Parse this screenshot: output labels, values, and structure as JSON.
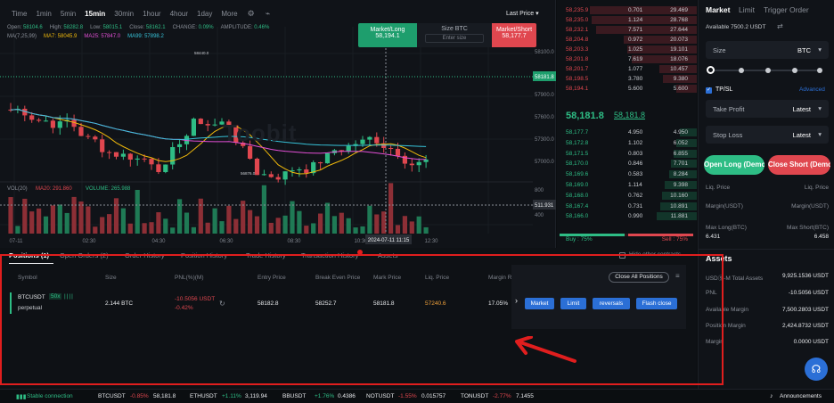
{
  "timeframes": [
    "Time",
    "1min",
    "5min",
    "15min",
    "30min",
    "1hour",
    "4hour",
    "1day",
    "More"
  ],
  "active_timeframe": "15min",
  "last_price_selector": "Last Price",
  "ohlc": {
    "open_label": "Open:",
    "open": "58104.6",
    "high_label": "High:",
    "high": "58282.8",
    "low_label": "Low:",
    "low": "58015.1",
    "close_label": "Close:",
    "close": "58162.1",
    "change_label": "CHANGE:",
    "change": "0.09%",
    "amplitude_label": "AMPLITUDE:",
    "amplitude": "0.46%"
  },
  "ma": {
    "setting": "MA(7,25,99)",
    "ma7": "MA7: 58045.9",
    "ma25": "MA25: 57847.0",
    "ma99": "MA99: 57898.2"
  },
  "watermark": "Toobit",
  "price_axis": [
    "58100.0",
    "57900.0",
    "57600.0",
    "57300.0",
    "57000.0"
  ],
  "current_price_tag": "58181.8",
  "price_annotations": {
    "high": "58440.0",
    "low": "56876.0"
  },
  "volume_axis": [
    "800",
    "400"
  ],
  "volume_tag": "511.931",
  "volume_legend": {
    "label": "VOL(20)",
    "ma20": "MA20: 291.860",
    "volume": "VOLUME: 265.988"
  },
  "time_axis": [
    "07-11",
    "02:30",
    "04:30",
    "06:30",
    "08:30",
    "10:30",
    "12:30"
  ],
  "crosshair_time": "2024-07-11 11:15",
  "quick_trade": {
    "long_label": "Market/Long",
    "long_price": "58,194.1",
    "size_label": "Size BTC",
    "size_placeholder": "Enter size",
    "short_label": "Market/Short",
    "short_price": "58,177.7"
  },
  "orderbook": {
    "asks": [
      [
        "58,235.9",
        "0.701",
        "29.469"
      ],
      [
        "58,235.0",
        "1.124",
        "28.768"
      ],
      [
        "58,232.1",
        "7.571",
        "27.644"
      ],
      [
        "58,204.8",
        "0.972",
        "20.073"
      ],
      [
        "58,203.3",
        "1.025",
        "19.101"
      ],
      [
        "58,201.8",
        "7.619",
        "18.076"
      ],
      [
        "58,201.7",
        "1.077",
        "10.457"
      ],
      [
        "58,198.5",
        "3.780",
        "9.380"
      ],
      [
        "58,194.1",
        "5.600",
        "5.600"
      ]
    ],
    "ask_depth": [
      1.0,
      0.98,
      0.94,
      0.68,
      0.65,
      0.61,
      0.35,
      0.32,
      0.19
    ],
    "mid_price": "58,181.8",
    "mark_price": "58,181.8",
    "bids": [
      [
        "58,177.7",
        "4.950",
        "4.950"
      ],
      [
        "58,172.8",
        "1.102",
        "6.052"
      ],
      [
        "58,171.5",
        "0.803",
        "6.855"
      ],
      [
        "58,170.0",
        "0.846",
        "7.701"
      ],
      [
        "58,169.6",
        "0.583",
        "8.284"
      ],
      [
        "58,169.0",
        "1.114",
        "9.398"
      ],
      [
        "58,168.0",
        "0.762",
        "10.160"
      ],
      [
        "58,167.4",
        "0.731",
        "10.891"
      ],
      [
        "58,166.0",
        "0.990",
        "11.881"
      ]
    ],
    "bid_depth": [
      0.42,
      0.51,
      0.58,
      0.65,
      0.7,
      0.79,
      0.86,
      0.92,
      1.0
    ],
    "buy_ratio": "Buy : 75%",
    "sell_ratio": "Sell : 75%",
    "buy_fraction": 0.5
  },
  "right_panel": {
    "tabs": [
      "Market",
      "Limit",
      "Trigger Order"
    ],
    "available": "Available 7500.2 USDT",
    "size_label": "Size",
    "size_unit": "BTC",
    "tpsl_label": "TP/SL",
    "advanced_label": "Advanced",
    "take_profit_label": "Take Profit",
    "take_profit_value": "Latest",
    "stop_loss_label": "Stop Loss",
    "stop_loss_value": "Latest",
    "open_long": "Open Long (Demo)",
    "open_short": "Close Short (Demo)",
    "liq_left": "Liq. Price",
    "liq_right": "Liq. Price",
    "margin_left": "Margin(USDT)",
    "margin_right": "Margin(USDT)",
    "maxlong_label": "Max Long(BTC)",
    "maxlong_value": "6.431",
    "maxshort_label": "Max Short(BTC)",
    "maxshort_value": "6.458",
    "assets_title": "Assets",
    "assets_rows": [
      [
        "USDⓈ-M Total Assets",
        "9,925.1536 USDT"
      ],
      [
        "PNL",
        "-10.5056 USDT"
      ],
      [
        "Available Margin",
        "7,500.2803 USDT"
      ],
      [
        "Position Margin",
        "2,424.8732 USDT"
      ],
      [
        "Margin",
        "0.0000 USDT"
      ]
    ]
  },
  "positions": {
    "tabs": [
      "Positions (1)",
      "Open Orders (2)",
      "Order History",
      "Position History",
      "Trade History",
      "Transaction History",
      "Assets"
    ],
    "hide_other": "Hide other contracts",
    "headers": [
      "Symbol",
      "Size",
      "PNL(%)(M)",
      "Entry Price",
      "Break Even Price",
      "Mark Price",
      "Liq. Price",
      "Margin R"
    ],
    "close_all": "Close All Positions",
    "row": {
      "symbol": "BTCUSDT",
      "leverage": "50x",
      "type": "perpetual",
      "size": "2.144 BTC",
      "pnl": "-10.5056 USDT",
      "pnl_pct": "-0.42%",
      "entry": "58182.8",
      "break_even": "58252.7",
      "mark": "58181.8",
      "liq": "57240.6",
      "margin_ratio": "17.05%"
    },
    "actions": [
      "Market",
      "Limit",
      "reversals",
      "Flash close"
    ]
  },
  "ticker": {
    "connection": "Stable connection",
    "items": [
      [
        "BTCUSDT",
        "-0.85%",
        "58,181.8"
      ],
      [
        "ETHUSDT",
        "+1.11%",
        "3,119.94"
      ],
      [
        "BBUSDT",
        "+1.76%",
        "0.4386"
      ],
      [
        "NOTUSDT",
        "-1.55%",
        "0.015757"
      ],
      [
        "TONUSDT",
        "-2.77%",
        "7.1455"
      ]
    ],
    "announcements": "Announcements"
  },
  "colors": {
    "up": "#2ebd85",
    "down": "#e0474f",
    "accent": "#2b6fd6",
    "highlight": "#e01e1e"
  }
}
